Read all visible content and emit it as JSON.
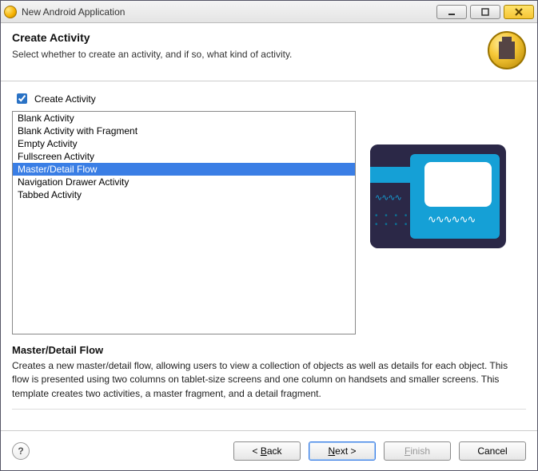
{
  "window": {
    "title": "New Android Application"
  },
  "header": {
    "title": "Create Activity",
    "subtitle": "Select whether to create an activity, and if so, what kind of activity."
  },
  "checkbox": {
    "label": "Create Activity",
    "checked": true
  },
  "activity_options": [
    "Blank Activity",
    "Blank Activity with Fragment",
    "Empty Activity",
    "Fullscreen Activity",
    "Master/Detail Flow",
    "Navigation Drawer Activity",
    "Tabbed Activity"
  ],
  "selected_index": 4,
  "description": {
    "title": "Master/Detail Flow",
    "body": "Creates a new master/detail flow, allowing users to view a collection of objects as well as details for each object. This flow is presented using two columns on tablet-size screens and one column on handsets and smaller screens. This template creates two activities, a master fragment, and a detail fragment."
  },
  "buttons": {
    "back": "< Back",
    "next": "Next >",
    "finish": "Finish",
    "cancel": "Cancel"
  }
}
